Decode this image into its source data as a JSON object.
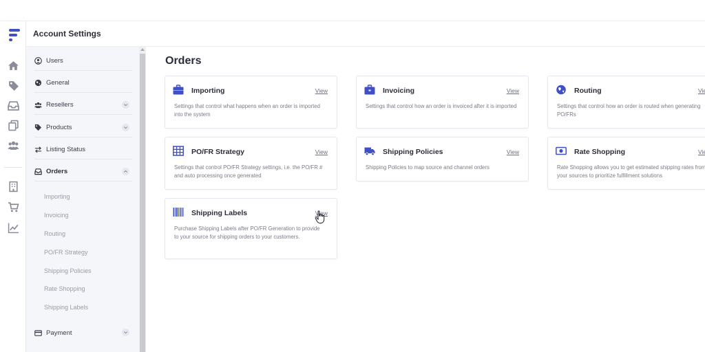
{
  "header": {
    "title": "Account Settings"
  },
  "rail": {
    "icons": [
      "logo-icon",
      "home-icon",
      "tag-icon",
      "inbox-icon",
      "copy-icon",
      "users-icon",
      "building-icon",
      "cart-icon",
      "chart-icon"
    ]
  },
  "sidebar": {
    "items": [
      {
        "label": "Users",
        "icon": "user-circle-icon"
      },
      {
        "label": "General",
        "icon": "globe-icon"
      },
      {
        "label": "Resellers",
        "icon": "users-icon",
        "chevron": "down"
      },
      {
        "label": "Products",
        "icon": "tag-icon",
        "chevron": "down"
      },
      {
        "label": "Listing Status",
        "icon": "exchange-icon"
      },
      {
        "label": "Orders",
        "icon": "inbox-icon",
        "chevron": "up",
        "active": true
      },
      {
        "label": "Payment",
        "icon": "credit-card-icon",
        "chevron": "down"
      }
    ],
    "sub_items": [
      "Importing",
      "Invoicing",
      "Routing",
      "PO/FR Strategy",
      "Shipping Policies",
      "Rate Shopping",
      "Shipping Labels"
    ]
  },
  "main": {
    "title": "Orders",
    "cards": [
      {
        "title": "Importing",
        "link": "View",
        "icon": "briefcase-icon",
        "desc": "Settings that control what happens when an order is imported into the system"
      },
      {
        "title": "Invoicing",
        "link": "View",
        "icon": "briefcase-icon",
        "desc": "Settings that control how an order is invoiced after it is imported"
      },
      {
        "title": "Routing",
        "link": "View",
        "icon": "globe-icon",
        "desc": "Settings that control how an order is routed when generating PO/FRs"
      },
      {
        "title": "PO/FR Strategy",
        "link": "View",
        "icon": "table-icon",
        "desc": "Settings that control PO/FR Strategy settings, i.e. the PO/FR # and auto processing once generated"
      },
      {
        "title": "Shipping Policies",
        "link": "View",
        "icon": "truck-icon",
        "desc": "Shipping Policies to map source and channel orders"
      },
      {
        "title": "Rate Shopping",
        "link": "View",
        "icon": "money-bill-icon",
        "desc": "Rate Shopping allows you to get estimated shipping rates from your sources to prioritize fulfillment solutions"
      },
      {
        "title": "Shipping Labels",
        "link": "View",
        "icon": "barcode-icon",
        "desc": "Purchase Shipping Labels after PO/FR Generation to provide to your source for shipping orders to your customers."
      }
    ]
  },
  "colors": {
    "accent": "#3f4fc4",
    "sidebar_bg": "#f5f6fa",
    "rail_icon": "#8a8c99"
  }
}
